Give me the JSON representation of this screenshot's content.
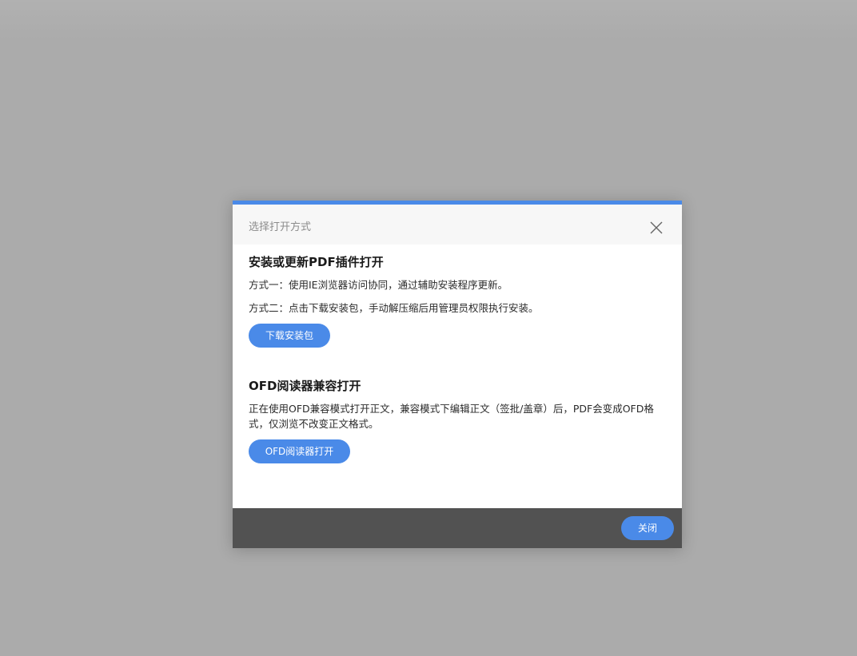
{
  "dialog": {
    "title": "选择打开方式",
    "close_icon": "close-x-icon",
    "accent_color": "#4a8ae8",
    "section1": {
      "heading": "安装或更新PDF插件打开",
      "line1": "方式一：使用IE浏览器访问协同，通过辅助安装程序更新。",
      "line2": "方式二：点击下载安装包，手动解压缩后用管理员权限执行安装。",
      "button": "下载安装包"
    },
    "section2": {
      "heading": "OFD阅读器兼容打开",
      "description": "正在使用OFD兼容模式打开正文，兼容模式下编辑正文（签批/盖章）后，PDF会变成OFD格式，仅浏览不改变正文格式。",
      "button": "OFD阅读器打开"
    },
    "footer": {
      "close_label": "关闭"
    }
  }
}
